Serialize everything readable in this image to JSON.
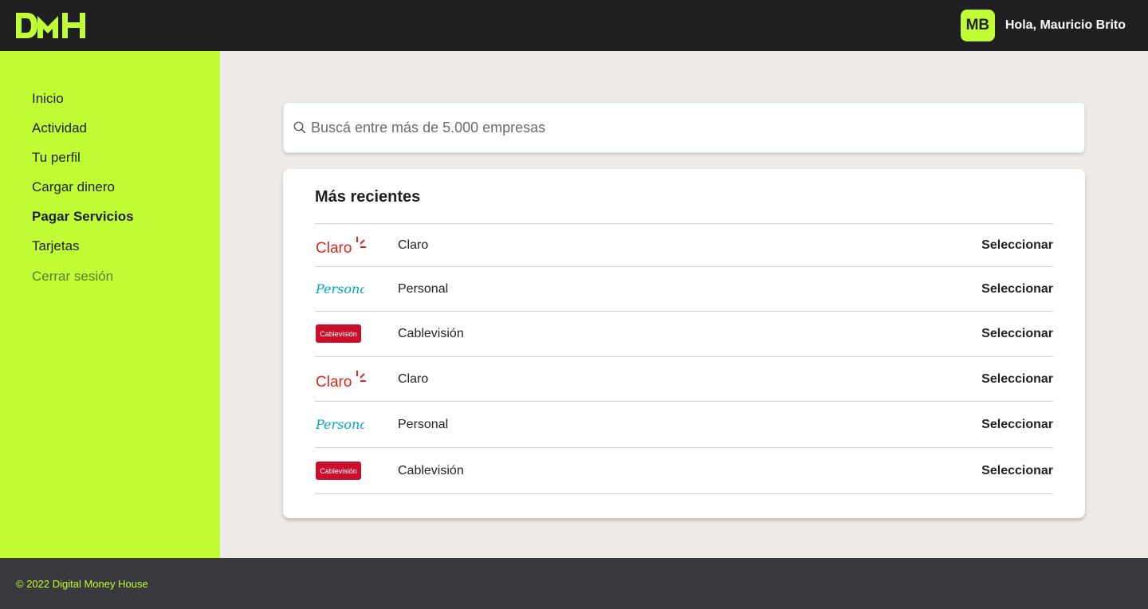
{
  "app": {
    "logo": "DMH",
    "brand_color": "#c1fd35",
    "dark_color": "#201f22"
  },
  "header": {
    "avatar_initials": "MB",
    "greeting": "Hola, Mauricio Brito"
  },
  "sidebar": {
    "items": [
      {
        "label": "Inicio"
      },
      {
        "label": "Actividad"
      },
      {
        "label": "Tu perfil"
      },
      {
        "label": "Cargar dinero"
      },
      {
        "label": "Pagar Servicios",
        "active": true
      },
      {
        "label": "Tarjetas"
      },
      {
        "label": "Cerrar sesión"
      }
    ]
  },
  "search": {
    "placeholder": "Buscá entre más de 5.000 empresas",
    "icon": "search-icon"
  },
  "recent": {
    "title": "Más recientes",
    "rows": [
      {
        "logo": "claro-logo",
        "logo_text": "Claro",
        "name": "Claro",
        "action": "Seleccionar"
      },
      {
        "logo": "personal-logo",
        "logo_text": "Personal",
        "name": "Personal",
        "action": "Seleccionar"
      },
      {
        "logo": "cablevision-logo",
        "logo_text": "Cablevisión",
        "name": "Cablevisión",
        "action": "Seleccionar"
      },
      {
        "logo": "claro-logo",
        "logo_text": "Claro",
        "name": "Claro",
        "action": "Seleccionar"
      },
      {
        "logo": "personal-logo",
        "logo_text": "Personal",
        "name": "Personal",
        "action": "Seleccionar"
      },
      {
        "logo": "cablevision-logo",
        "logo_text": "Cablevisión",
        "name": "Cablevisión",
        "action": "Seleccionar"
      }
    ]
  },
  "footer": {
    "copyright": "© 2022 Digital Money House"
  }
}
